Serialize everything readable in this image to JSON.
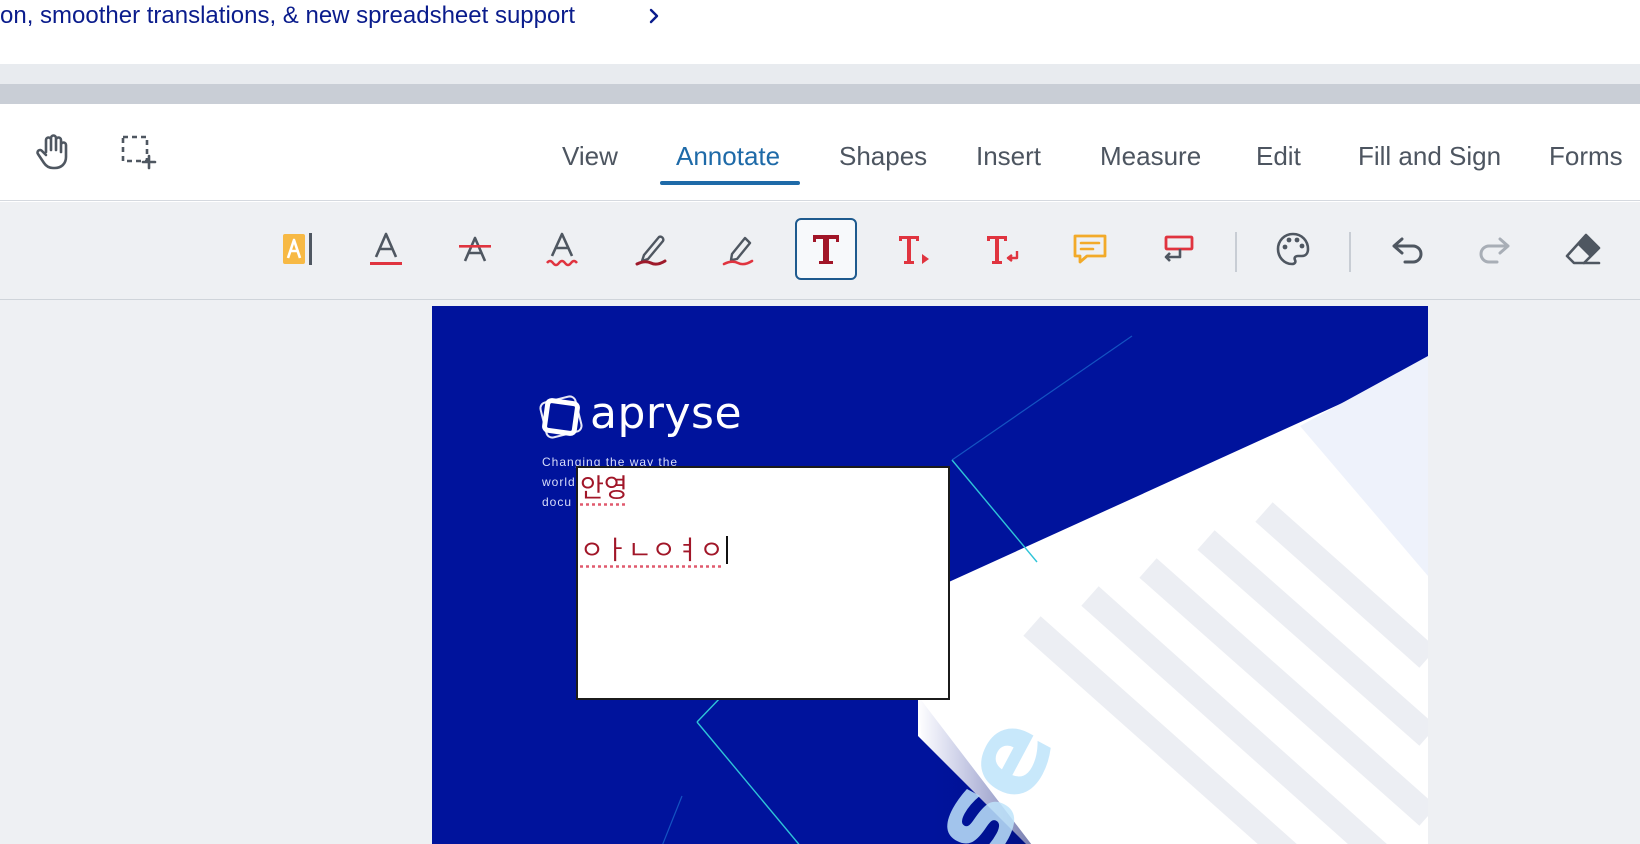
{
  "banner": {
    "text": "on, smoother translations, & new spreadsheet support"
  },
  "menubar": {
    "tools": [
      {
        "icon": "pan-hand-icon"
      },
      {
        "icon": "marquee-select-icon"
      }
    ],
    "tabs": [
      {
        "label": "View"
      },
      {
        "label": "Annotate",
        "active": true
      },
      {
        "label": "Shapes"
      },
      {
        "label": "Insert"
      },
      {
        "label": "Measure"
      },
      {
        "label": "Edit"
      },
      {
        "label": "Fill and Sign"
      },
      {
        "label": "Forms"
      }
    ]
  },
  "toolbar": {
    "buttons": [
      {
        "icon": "text-highlight-icon"
      },
      {
        "icon": "text-underline-icon"
      },
      {
        "icon": "text-strikeout-icon"
      },
      {
        "icon": "text-squiggly-icon"
      },
      {
        "icon": "freehand-pen-icon"
      },
      {
        "icon": "freehand-highlight-icon"
      },
      {
        "icon": "free-text-icon",
        "selected": true
      },
      {
        "icon": "insert-text-icon"
      },
      {
        "icon": "replace-text-icon"
      },
      {
        "icon": "sticky-note-icon"
      },
      {
        "icon": "callout-icon"
      },
      {
        "icon": "style-palette-icon"
      },
      {
        "icon": "undo-icon"
      },
      {
        "icon": "redo-icon"
      },
      {
        "icon": "eraser-icon"
      }
    ]
  },
  "document": {
    "brand": "apryse",
    "tagline_lines": [
      "Changing the way the",
      "world",
      "docu"
    ],
    "textbox": {
      "line1": "안영",
      "line2": "ㅇㅏㄴㅇㅕㅇ"
    }
  },
  "colors": {
    "accent": "#1e6aa8",
    "page_blue": "#00139c",
    "annot_text": "#a11628",
    "banner_text": "#0a1c8c"
  }
}
